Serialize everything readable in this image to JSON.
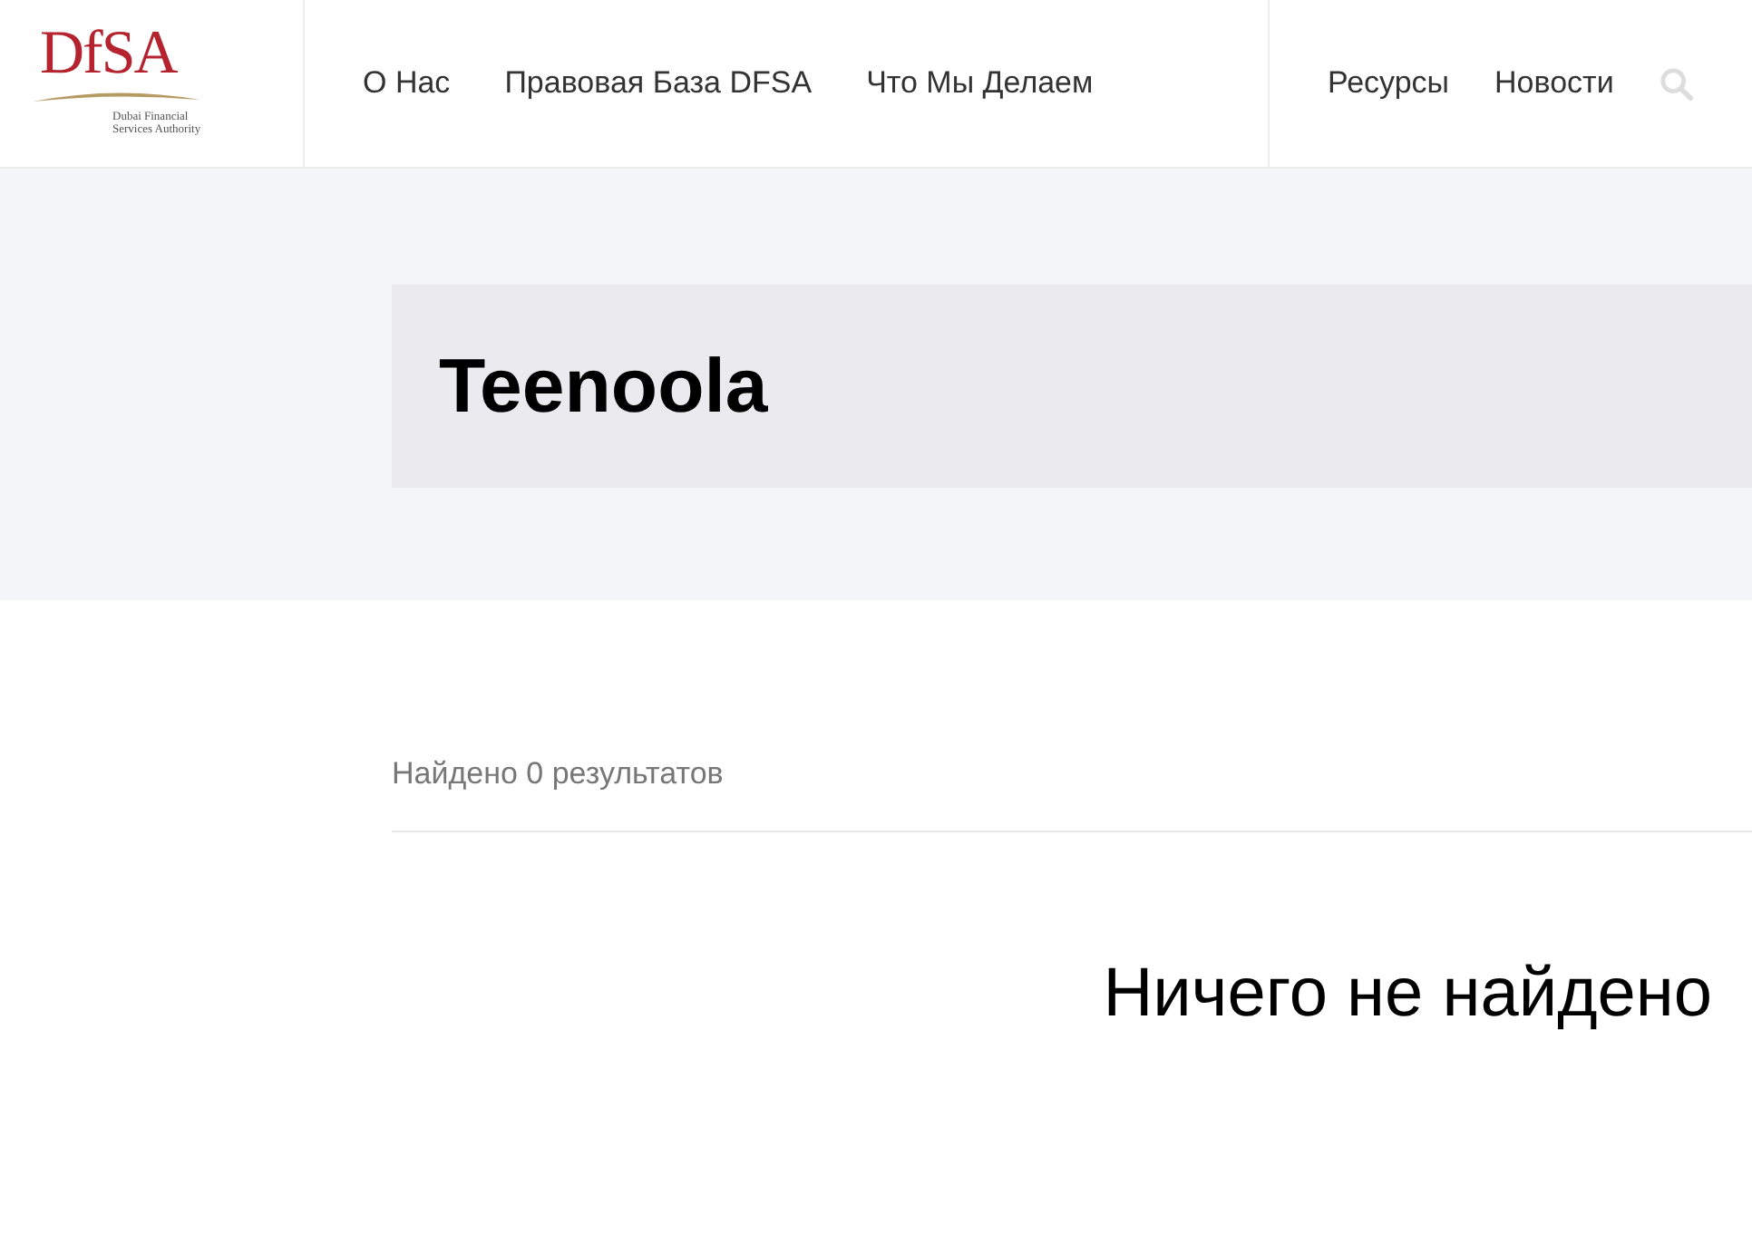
{
  "logo": {
    "wordmark": "DfSA",
    "tagline": [
      "Dubai Financial",
      "Services Authority"
    ]
  },
  "nav_main": [
    "О Нас",
    "Правовая База DFSA",
    "Что Мы Делаем"
  ],
  "nav_secondary": [
    "Ресурсы",
    "Новости"
  ],
  "page_title": "Teenoola",
  "results_count": "Найдено 0 результатов",
  "empty_message": "Ничего не найдено"
}
